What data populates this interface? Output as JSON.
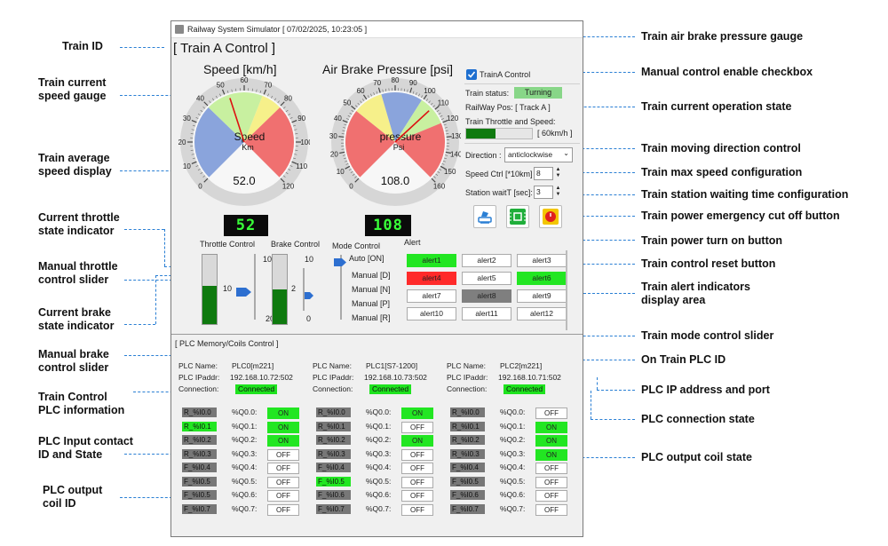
{
  "window": {
    "title": "Railway System Simulator [ 07/02/2025, 10:23:05 ]"
  },
  "panel_title": "[ Train A Control ]",
  "speed_gauge": {
    "title": "Speed [km/h]",
    "label": "Speed",
    "unit": "Km",
    "value": "52.0",
    "ticks": [
      "0",
      "10",
      "20",
      "30",
      "40",
      "50",
      "60",
      "70",
      "80",
      "90",
      "100",
      "110",
      "120"
    ]
  },
  "pressure_gauge": {
    "title": "Air Brake Pressure [psi]",
    "label": "pressure",
    "unit": "Psi",
    "value": "108.0",
    "ticks": [
      "0",
      "10",
      "20",
      "30",
      "40",
      "50",
      "60",
      "70",
      "80",
      "90",
      "100",
      "110",
      "120",
      "130",
      "140",
      "150",
      "160"
    ]
  },
  "lcd_speed": "52",
  "lcd_pressure": "108",
  "throttle": {
    "label": "Throttle Control",
    "max": "100",
    "mid": "10",
    "min": "20",
    "fill_fraction": 0.55
  },
  "brake": {
    "label": "Brake Control",
    "max": "10",
    "mid": "2",
    "min": "0",
    "fill_fraction": 0.5
  },
  "mode": {
    "label": "Mode Control",
    "options": [
      "Auto [ON]",
      "Manual [D]",
      "Manual [N]",
      "Manual [P]",
      "Manual [R]"
    ]
  },
  "control_panel": {
    "checkbox_label": "TrainA Control",
    "status_label": "Train status:",
    "status_value": "Turning",
    "railway_pos": "RailWay Pos: [ Track A ]",
    "throttle_speed_label": "Train Throttle and Speed:",
    "throttle_speed_value": "[ 60km/h ]",
    "throttle_progress": 0.45,
    "direction_label": "Direction :",
    "direction_value": "anticlockwise",
    "speed_ctrl_label": "Speed Ctrl [*10km]",
    "speed_ctrl_value": "8",
    "station_wait_label": "Station waitT [sec]:",
    "station_wait_value": "3"
  },
  "alerts": {
    "title": "Alert",
    "items": [
      {
        "label": "alert1",
        "color": "#22e622"
      },
      {
        "label": "alert2",
        "color": "#ffffff"
      },
      {
        "label": "alert3",
        "color": "#ffffff"
      },
      {
        "label": "alert4",
        "color": "#ff2a2a"
      },
      {
        "label": "alert5",
        "color": "#ffffff"
      },
      {
        "label": "alert6",
        "color": "#22e622"
      },
      {
        "label": "alert7",
        "color": "#ffffff"
      },
      {
        "label": "alert8",
        "color": "#7f7f7f"
      },
      {
        "label": "alert9",
        "color": "#ffffff"
      },
      {
        "label": "alert10",
        "color": "#ffffff"
      },
      {
        "label": "alert11",
        "color": "#ffffff"
      },
      {
        "label": "alert12",
        "color": "#ffffff"
      }
    ]
  },
  "plc_section_title": "[ PLC Memory/Coils Control ]",
  "plcs": [
    {
      "name_label": "PLC Name:",
      "name": "PLC0[m221]",
      "ip_label": "PLC IPaddr:",
      "ip": "192.168.10.72:502",
      "conn_label": "Connection:",
      "conn": "Connected",
      "inputs": [
        {
          "id": "R_%I0.0",
          "on": false
        },
        {
          "id": "R_%I0.1",
          "on": true
        },
        {
          "id": "R_%I0.2",
          "on": false
        },
        {
          "id": "R_%I0.3",
          "on": false
        },
        {
          "id": "F_%I0.4",
          "on": false
        },
        {
          "id": "F_%I0.5",
          "on": false
        },
        {
          "id": "F_%I0.5",
          "on": false
        },
        {
          "id": "F_%I0.7",
          "on": false
        }
      ],
      "coils": [
        {
          "id": "%Q0.0:",
          "state": "ON"
        },
        {
          "id": "%Q0.1:",
          "state": "ON"
        },
        {
          "id": "%Q0.2:",
          "state": "ON"
        },
        {
          "id": "%Q0.3:",
          "state": "OFF"
        },
        {
          "id": "%Q0.4:",
          "state": "OFF"
        },
        {
          "id": "%Q0.5:",
          "state": "OFF"
        },
        {
          "id": "%Q0.6:",
          "state": "OFF"
        },
        {
          "id": "%Q0.7:",
          "state": "OFF"
        }
      ]
    },
    {
      "name_label": "PLC Name:",
      "name": "PLC1[S7-1200]",
      "ip_label": "PLC IPaddr:",
      "ip": "192.168.10.73:502",
      "conn_label": "Connection:",
      "conn": "Connected",
      "inputs": [
        {
          "id": "R_%I0.0",
          "on": false
        },
        {
          "id": "R_%I0.1",
          "on": false
        },
        {
          "id": "R_%I0.2",
          "on": false
        },
        {
          "id": "R_%I0.3",
          "on": false
        },
        {
          "id": "F_%I0.4",
          "on": false
        },
        {
          "id": "F_%I0.5",
          "on": true
        },
        {
          "id": "F_%I0.6",
          "on": false
        },
        {
          "id": "F_%I0.7",
          "on": false
        }
      ],
      "coils": [
        {
          "id": "%Q0.0:",
          "state": "ON"
        },
        {
          "id": "%Q0.1:",
          "state": "OFF"
        },
        {
          "id": "%Q0.2:",
          "state": "ON"
        },
        {
          "id": "%Q0.3:",
          "state": "OFF"
        },
        {
          "id": "%Q0.4:",
          "state": "OFF"
        },
        {
          "id": "%Q0.5:",
          "state": "OFF"
        },
        {
          "id": "%Q0.6:",
          "state": "OFF"
        },
        {
          "id": "%Q0.7:",
          "state": "OFF"
        }
      ]
    },
    {
      "name_label": "PLC Name:",
      "name": "PLC2[m221]",
      "ip_label": "PLC IPaddr:",
      "ip": "192.168.10.71:502",
      "conn_label": "Connection:",
      "conn": "Connected",
      "inputs": [
        {
          "id": "R_%I0.0",
          "on": false
        },
        {
          "id": "R_%I0.1",
          "on": false
        },
        {
          "id": "R_%I0.2",
          "on": false
        },
        {
          "id": "R_%I0.3",
          "on": false
        },
        {
          "id": "F_%I0.4",
          "on": false
        },
        {
          "id": "F_%I0.5",
          "on": false
        },
        {
          "id": "F_%I0.6",
          "on": false
        },
        {
          "id": "F_%I0.7",
          "on": false
        }
      ],
      "coils": [
        {
          "id": "%Q0.0:",
          "state": "OFF"
        },
        {
          "id": "%Q0.1:",
          "state": "ON"
        },
        {
          "id": "%Q0.2:",
          "state": "ON"
        },
        {
          "id": "%Q0.3:",
          "state": "ON"
        },
        {
          "id": "%Q0.4:",
          "state": "OFF"
        },
        {
          "id": "%Q0.5:",
          "state": "OFF"
        },
        {
          "id": "%Q0.6:",
          "state": "OFF"
        },
        {
          "id": "%Q0.7:",
          "state": "OFF"
        }
      ]
    }
  ],
  "annotations": {
    "train_id": "Train ID",
    "speed_gauge": "Train current\nspeed gauge",
    "avg_speed": "Train average\nspeed display",
    "throttle_state": "Current throttle\nstate indicator",
    "throttle_slider": "Manual throttle\ncontrol slider",
    "brake_state": "Current brake\nstate indicator",
    "brake_slider": "Manual brake\ncontrol slider",
    "plc_info": "Train Control\nPLC information",
    "plc_input": "PLC Input contact\nID and State",
    "plc_coil_id": "PLC output\ncoil ID",
    "air_brake": "Train air brake pressure gauge",
    "manual_enable": "Manual control enable checkbox",
    "op_state": "Train current operation state",
    "direction": "Train moving direction control",
    "max_speed": "Train max speed configuration",
    "wait_time": "Train station waiting time configuration",
    "emergency": "Train power emergency cut off button",
    "power_on": "Train power turn on button",
    "reset": "Train control reset button",
    "alert_area": "Train alert indicators\ndisplay area",
    "mode_slider": "Train mode control slider",
    "plc_id": "On Train PLC ID",
    "plc_ip": "PLC IP address and port",
    "plc_conn": "PLC connection state",
    "plc_coil_state": "PLC output coil state"
  }
}
